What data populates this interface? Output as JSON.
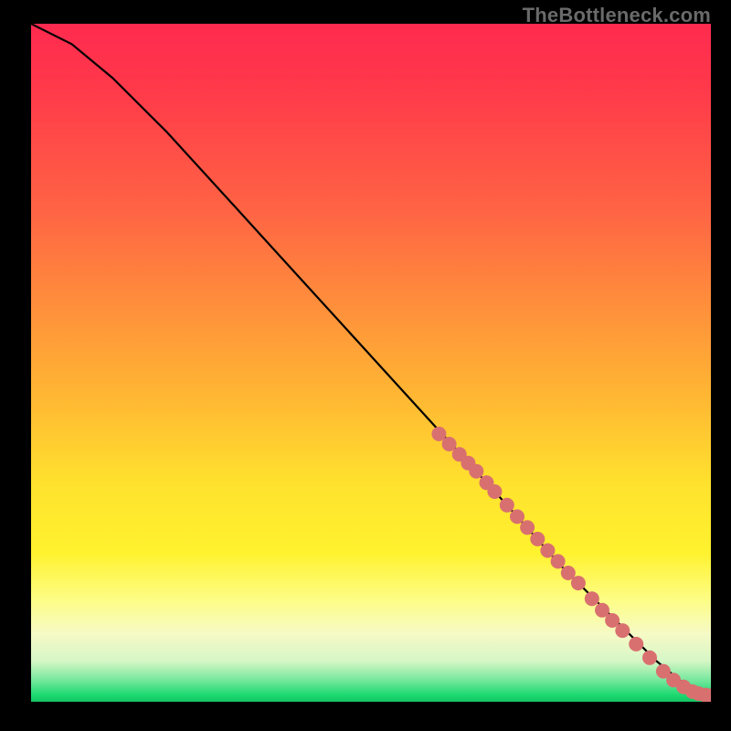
{
  "watermark": "TheBottleneck.com",
  "colors": {
    "curve": "#000000",
    "dot": "#d97070"
  },
  "chart_data": {
    "type": "line",
    "title": "",
    "xlabel": "",
    "ylabel": "",
    "xlim": [
      0,
      100
    ],
    "ylim": [
      0,
      100
    ],
    "series": [
      {
        "name": "curve",
        "x": [
          0,
          6,
          12,
          20,
          30,
          40,
          50,
          60,
          70,
          78,
          84,
          88,
          92,
          95,
          97,
          98.5,
          100
        ],
        "y": [
          100,
          97,
          92,
          84,
          73,
          62,
          51,
          40,
          29,
          20,
          14,
          10,
          6,
          3.5,
          2,
          1.2,
          0.8
        ]
      }
    ],
    "points": [
      {
        "x": 60,
        "y": 39.5
      },
      {
        "x": 61.5,
        "y": 38
      },
      {
        "x": 63,
        "y": 36.5
      },
      {
        "x": 64.3,
        "y": 35.2
      },
      {
        "x": 65.5,
        "y": 34
      },
      {
        "x": 67,
        "y": 32.3
      },
      {
        "x": 68.2,
        "y": 31
      },
      {
        "x": 70,
        "y": 29
      },
      {
        "x": 71.5,
        "y": 27.3
      },
      {
        "x": 73,
        "y": 25.7
      },
      {
        "x": 74.5,
        "y": 24
      },
      {
        "x": 76,
        "y": 22.3
      },
      {
        "x": 77.5,
        "y": 20.7
      },
      {
        "x": 79,
        "y": 19
      },
      {
        "x": 80.5,
        "y": 17.5
      },
      {
        "x": 82.5,
        "y": 15.2
      },
      {
        "x": 84,
        "y": 13.5
      },
      {
        "x": 85.5,
        "y": 12
      },
      {
        "x": 87,
        "y": 10.5
      },
      {
        "x": 89,
        "y": 8.5
      },
      {
        "x": 91,
        "y": 6.5
      },
      {
        "x": 93,
        "y": 4.5
      },
      {
        "x": 94.5,
        "y": 3.2
      },
      {
        "x": 96,
        "y": 2.2
      },
      {
        "x": 97.3,
        "y": 1.5
      },
      {
        "x": 98.2,
        "y": 1.2
      },
      {
        "x": 99.2,
        "y": 1.0
      },
      {
        "x": 100,
        "y": 0.9
      }
    ]
  }
}
